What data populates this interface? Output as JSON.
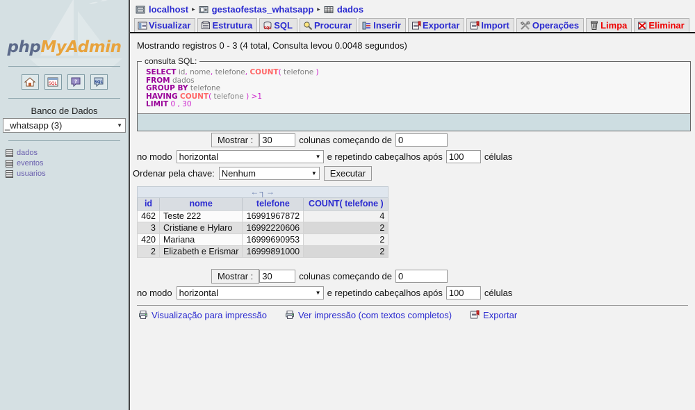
{
  "sidebar": {
    "logo": {
      "part1": "php",
      "part2": "My",
      "part3": "Admin"
    },
    "nav_icons": [
      {
        "name": "home-icon",
        "title": "Home"
      },
      {
        "name": "sql-window-icon",
        "title": "SQL"
      },
      {
        "name": "help-icon",
        "title": "Help"
      },
      {
        "name": "sql-query-icon",
        "title": "Query"
      }
    ],
    "db_title": "Banco de Dados",
    "db_selected": "_whatsapp (3)",
    "db_caret": "▼",
    "tables": [
      {
        "label": "dados"
      },
      {
        "label": "eventos"
      },
      {
        "label": "usuarios"
      }
    ]
  },
  "breadcrumb": {
    "separator": "▸",
    "items": [
      {
        "label": "localhost",
        "icon": "server-icon"
      },
      {
        "label": "gestaofestas_whatsapp",
        "icon": "database-icon"
      },
      {
        "label": "dados",
        "icon": "table-icon"
      }
    ]
  },
  "tabs": [
    {
      "label": "Visualizar",
      "icon": "browse-icon",
      "danger": false
    },
    {
      "label": "Estrutura",
      "icon": "structure-icon",
      "danger": false
    },
    {
      "label": "SQL",
      "icon": "sql-icon",
      "danger": false
    },
    {
      "label": "Procurar",
      "icon": "search-icon",
      "danger": false
    },
    {
      "label": "Inserir",
      "icon": "insert-icon",
      "danger": false
    },
    {
      "label": "Exportar",
      "icon": "export-icon",
      "danger": false
    },
    {
      "label": "Import",
      "icon": "import-icon",
      "danger": false
    },
    {
      "label": "Operações",
      "icon": "operations-icon",
      "danger": false
    },
    {
      "label": "Limpa",
      "icon": "trash-icon",
      "danger": true
    },
    {
      "label": "Eliminar",
      "icon": "drop-icon",
      "danger": true
    }
  ],
  "status_text": "Mostrando registros 0 - 3 (4 total, Consulta levou 0.0048 segundos)",
  "sql": {
    "legend": "consulta SQL:",
    "lines": [
      [
        {
          "t": "SELECT",
          "c": "kw"
        },
        {
          "t": " ",
          "c": "pl"
        },
        {
          "t": "id",
          "c": "pl"
        },
        {
          "t": ", ",
          "c": "pn"
        },
        {
          "t": "nome",
          "c": "pl"
        },
        {
          "t": ", ",
          "c": "pn"
        },
        {
          "t": "telefone",
          "c": "pl"
        },
        {
          "t": ", ",
          "c": "pn"
        },
        {
          "t": "COUNT",
          "c": "fn"
        },
        {
          "t": "( ",
          "c": "pn"
        },
        {
          "t": "telefone",
          "c": "pl"
        },
        {
          "t": " )",
          "c": "pn"
        }
      ],
      [
        {
          "t": "FROM",
          "c": "kw"
        },
        {
          "t": " ",
          "c": "pl"
        },
        {
          "t": "dados",
          "c": "pl"
        }
      ],
      [
        {
          "t": "GROUP BY",
          "c": "kw"
        },
        {
          "t": " ",
          "c": "pl"
        },
        {
          "t": "telefone",
          "c": "pl"
        }
      ],
      [
        {
          "t": "HAVING",
          "c": "kw"
        },
        {
          "t": " ",
          "c": "pl"
        },
        {
          "t": "COUNT",
          "c": "fn"
        },
        {
          "t": "( ",
          "c": "pn"
        },
        {
          "t": "telefone",
          "c": "pl"
        },
        {
          "t": " ) ",
          "c": "pn"
        },
        {
          "t": ">",
          "c": "op"
        },
        {
          "t": "1",
          "c": "pn"
        }
      ],
      [
        {
          "t": "LIMIT",
          "c": "kw"
        },
        {
          "t": " ",
          "c": "pl"
        },
        {
          "t": "0",
          "c": "pn"
        },
        {
          "t": " , ",
          "c": "pn"
        },
        {
          "t": "30",
          "c": "pn"
        }
      ]
    ]
  },
  "display_form_top": {
    "show_button": "Mostrar :",
    "rows_value": "30",
    "columns_label": "colunas começando de",
    "start_value": "0",
    "mode_label": "no modo",
    "mode_value": "horizontal",
    "repeat_label": "e repetindo cabeçalhos após",
    "repeat_value": "100",
    "cells_label": "células",
    "order_label": "Ordenar pela chave:",
    "order_value": "Nenhum",
    "execute_button": "Executar",
    "caret": "▼"
  },
  "display_form_bottom": {
    "show_button": "Mostrar :",
    "rows_value": "30",
    "columns_label": "colunas começando de",
    "start_value": "0",
    "mode_label": "no modo",
    "mode_value": "horizontal",
    "repeat_label": "e repetindo cabeçalhos após",
    "repeat_value": "100",
    "cells_label": "células",
    "caret": "▼"
  },
  "results": {
    "sort_hint": "←┐→",
    "headers": [
      "id",
      "nome",
      "telefone",
      "COUNT( telefone )"
    ],
    "rows": [
      {
        "id": "462",
        "nome": "Teste 222",
        "telefone": "16991967872",
        "count": "4"
      },
      {
        "id": "3",
        "nome": "Cristiane e Hylaro",
        "telefone": "16992220606",
        "count": "2"
      },
      {
        "id": "420",
        "nome": "Mariana",
        "telefone": "16999690953",
        "count": "2"
      },
      {
        "id": "2",
        "nome": "Elizabeth e Erismar",
        "telefone": "16999891000",
        "count": "2"
      }
    ]
  },
  "bottom_links": [
    {
      "label": "Visualização para impressão",
      "icon": "printer-icon"
    },
    {
      "label": "Ver impressão (com textos completos)",
      "icon": "printer-icon"
    },
    {
      "label": "Exportar",
      "icon": "export-icon"
    }
  ],
  "colors": {
    "link": "#2b2bd0",
    "danger": "#ee0000",
    "sidebar_bg": "#d5e0e3",
    "sql_keyword": "#990099",
    "sql_function": "#ff6666",
    "table_header_text": "#2b2bd0"
  }
}
